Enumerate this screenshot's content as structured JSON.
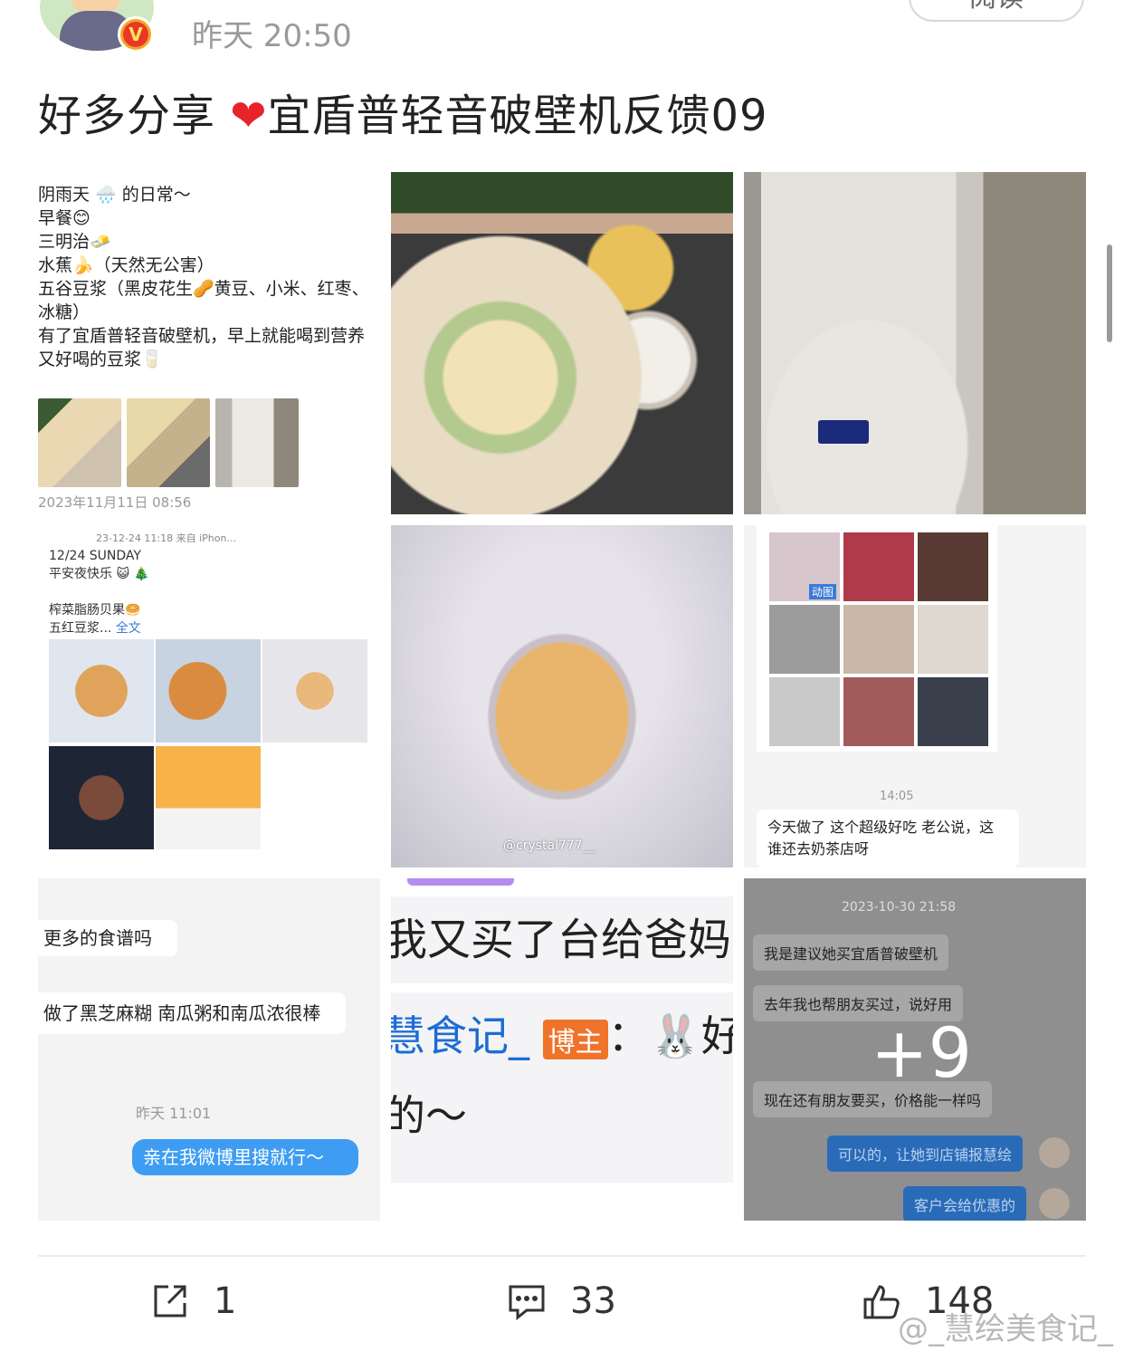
{
  "post": {
    "time": "昨天 20:50",
    "read_button": "阅读",
    "title_before_heart": "好多分享 ",
    "title_after_heart": "宜盾普轻音破壁机反馈09"
  },
  "grid": {
    "cell1": {
      "lines": "阴雨天 🌧️ 的日常～\n早餐😊\n三明治🧈\n水蕉🍌（天然无公害）\n五谷豆浆（黑皮花生🥜黄豆、小米、红枣、\n冰糖）\n有了宜盾普轻音破壁机，早上就能喝到营养\n又好喝的豆浆🥛",
      "date": "2023年11月11日 08:56"
    },
    "cell4": {
      "meta": "23-12-24 11:18  来自 iPhon...",
      "text": "12/24 SUNDAY\n平安夜快乐 😺 🎄\n\n榨菜脂肠贝果🥯\n五红豆浆... ",
      "more": "全文"
    },
    "cell5": {
      "watermark": "@crystal777__"
    },
    "cell6": {
      "tag": "动图",
      "time": "14:05",
      "message": "今天做了 这个超级好吃 老公说，这谁还去奶茶店呀"
    },
    "cell7": {
      "msg1": "更多的食谱吗",
      "msg2": "做了黑芝麻糊 南瓜粥和南瓜浓很棒",
      "time": "昨天 11:01",
      "reply": "亲在我微博里搜就行～"
    },
    "cell8": {
      "line1": "我又买了台给爸妈",
      "name": "慧食记_",
      "tag": "博主",
      "colon": "：🐰好多",
      "line2": "的～"
    },
    "cell9": {
      "timestamp": "2023-10-30 21:58",
      "m1": "我是建议她买宜盾普破壁机",
      "m2": "去年我也帮朋友买过，说好用",
      "m3": "现在还有朋友要买，价格能一样吗",
      "r1": "可以的，让她到店铺报慧绘",
      "r2": "客户会给优惠的",
      "more_count": "+9"
    }
  },
  "actions": {
    "share_count": "1",
    "comment_count": "33",
    "like_count": "148"
  },
  "watermark": "@_慧绘美食记_",
  "colors": {
    "heart": "#e8232a",
    "link": "#3b7bd6",
    "chat_blue": "#3e9df2"
  }
}
